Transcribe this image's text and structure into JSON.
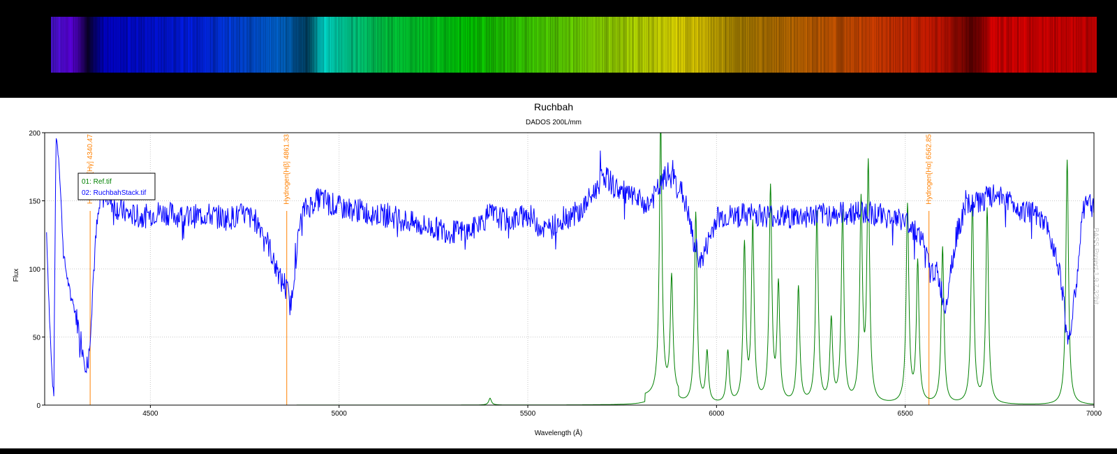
{
  "spectrum_strip": {
    "colors": {
      "background": "#000000"
    }
  },
  "chart_data": {
    "type": "line",
    "title": "Ruchbah",
    "subtitle": "DADOS 200L/mm",
    "xlabel": "Wavelength (Å)",
    "ylabel": "Flux",
    "xlim": [
      4220,
      7000
    ],
    "ylim": [
      0,
      200
    ],
    "x_ticks": [
      4500,
      5000,
      5500,
      6000,
      6500,
      7000
    ],
    "y_ticks": [
      0,
      50,
      100,
      150,
      200
    ],
    "grid": true,
    "legend_position": "top-left",
    "watermark": "BASS Project 1.9.7 32bit",
    "reference_lines": [
      {
        "label": "Hydrogen[Hγ] 4340.47",
        "x": 4340.47
      },
      {
        "label": "Hydrogen[Hβ] 4861.33",
        "x": 4861.33
      },
      {
        "label": "Hydrogen[Hα] 6562.85",
        "x": 6562.85
      }
    ],
    "series": [
      {
        "name": "01: Ref.tif",
        "color": "#008000",
        "kind": "emission-lines",
        "baseline": 0,
        "peaks": [
          {
            "x": 5400,
            "y": 5
          },
          {
            "x": 5852,
            "y": 200
          },
          {
            "x": 5881,
            "y": 86
          },
          {
            "x": 5945,
            "y": 140
          },
          {
            "x": 5975,
            "y": 37
          },
          {
            "x": 6030,
            "y": 38
          },
          {
            "x": 6074,
            "y": 115
          },
          {
            "x": 6096,
            "y": 130
          },
          {
            "x": 6143,
            "y": 157
          },
          {
            "x": 6164,
            "y": 85
          },
          {
            "x": 6217,
            "y": 85
          },
          {
            "x": 6266,
            "y": 140
          },
          {
            "x": 6304,
            "y": 60
          },
          {
            "x": 6334,
            "y": 140
          },
          {
            "x": 6383,
            "y": 145
          },
          {
            "x": 6402,
            "y": 173
          },
          {
            "x": 6506,
            "y": 145
          },
          {
            "x": 6533,
            "y": 103
          },
          {
            "x": 6599,
            "y": 115
          },
          {
            "x": 6678,
            "y": 150
          },
          {
            "x": 6717,
            "y": 143
          },
          {
            "x": 6929,
            "y": 180
          }
        ]
      },
      {
        "name": "02: RuchbahStack.tif",
        "color": "#0000ff",
        "kind": "continuum",
        "x": [
          4225,
          4232,
          4238,
          4244,
          4250,
          4258,
          4270,
          4285,
          4300,
          4315,
          4325,
          4335,
          4342,
          4350,
          4358,
          4368,
          4380,
          4395,
          4410,
          4440,
          4480,
          4520,
          4560,
          4600,
          4650,
          4700,
          4750,
          4780,
          4800,
          4820,
          4835,
          4848,
          4856,
          4864,
          4872,
          4880,
          4890,
          4900,
          4915,
          4930,
          4950,
          5000,
          5050,
          5100,
          5150,
          5200,
          5250,
          5300,
          5350,
          5400,
          5450,
          5500,
          5550,
          5600,
          5640,
          5660,
          5680,
          5700,
          5730,
          5760,
          5790,
          5820,
          5850,
          5870,
          5890,
          5910,
          5925,
          5940,
          5960,
          6000,
          6100,
          6200,
          6300,
          6400,
          6500,
          6540,
          6556,
          6566,
          6580,
          6595,
          6605,
          6620,
          6640,
          6660,
          6700,
          6750,
          6800,
          6840,
          6870,
          6890,
          6910,
          6925,
          6935,
          6950,
          6970,
          6985,
          7000
        ],
        "y": [
          127,
          70,
          30,
          3,
          200,
          180,
          110,
          85,
          70,
          50,
          35,
          28,
          60,
          100,
          130,
          150,
          155,
          150,
          145,
          140,
          138,
          142,
          140,
          138,
          140,
          137,
          140,
          135,
          128,
          112,
          98,
          90,
          90,
          82,
          72,
          95,
          118,
          140,
          145,
          148,
          152,
          145,
          143,
          140,
          138,
          133,
          130,
          127,
          128,
          140,
          135,
          140,
          128,
          138,
          142,
          150,
          158,
          170,
          160,
          155,
          150,
          147,
          160,
          170,
          165,
          155,
          140,
          118,
          105,
          138,
          140,
          138,
          140,
          142,
          135,
          125,
          110,
          96,
          100,
          85,
          70,
          100,
          130,
          145,
          150,
          155,
          145,
          140,
          132,
          120,
          100,
          60,
          48,
          80,
          140,
          150,
          145
        ]
      }
    ]
  }
}
